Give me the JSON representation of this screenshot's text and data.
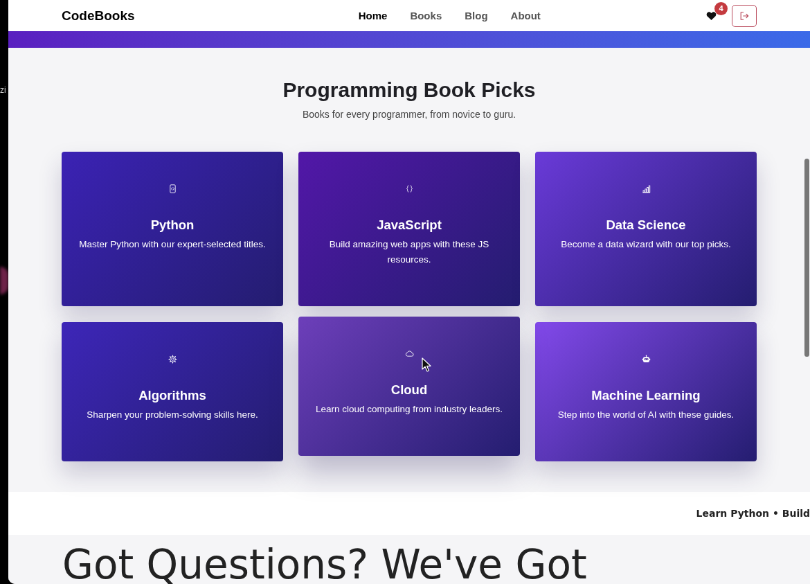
{
  "backdrop": {
    "text": "zi"
  },
  "nav": {
    "brand": "CodeBooks",
    "links": [
      {
        "label": "Home",
        "selected": true
      },
      {
        "label": "Books",
        "selected": false
      },
      {
        "label": "Blog",
        "selected": false
      },
      {
        "label": "About",
        "selected": false
      }
    ],
    "favorites": {
      "count": "4"
    }
  },
  "hero": {
    "title": "Programming Book Picks",
    "subtitle": "Books for every programmer, from novice to guru."
  },
  "categories": [
    {
      "kind": "file",
      "title": "Python",
      "description": "Master Python with our expert-selected titles.",
      "color": "#3b22b4",
      "hovered": false
    },
    {
      "kind": "braces",
      "title": "JavaScript",
      "description": "Build amazing web apps with these JS resources.",
      "color": "#5217a8",
      "hovered": false
    },
    {
      "kind": "chart",
      "title": "Data Science",
      "description": "Become a data wizard with our top picks.",
      "color": "#6a3ad8",
      "hovered": false
    },
    {
      "kind": "gear",
      "title": "Algorithms",
      "description": "Sharpen your problem-solving skills here.",
      "color": "#3d26b8",
      "hovered": false
    },
    {
      "kind": "cloud",
      "title": "Cloud",
      "description": "Learn cloud computing from industry leaders.",
      "color": "#6d3fba",
      "hovered": true
    },
    {
      "kind": "robot",
      "title": "Machine Learning",
      "description": "Step into the world of AI with these guides.",
      "color": "#8249ea",
      "hovered": false
    }
  ],
  "ticker": {
    "text": "Learn Python • Build"
  },
  "faq": {
    "title": "Got Questions? We've Got"
  }
}
